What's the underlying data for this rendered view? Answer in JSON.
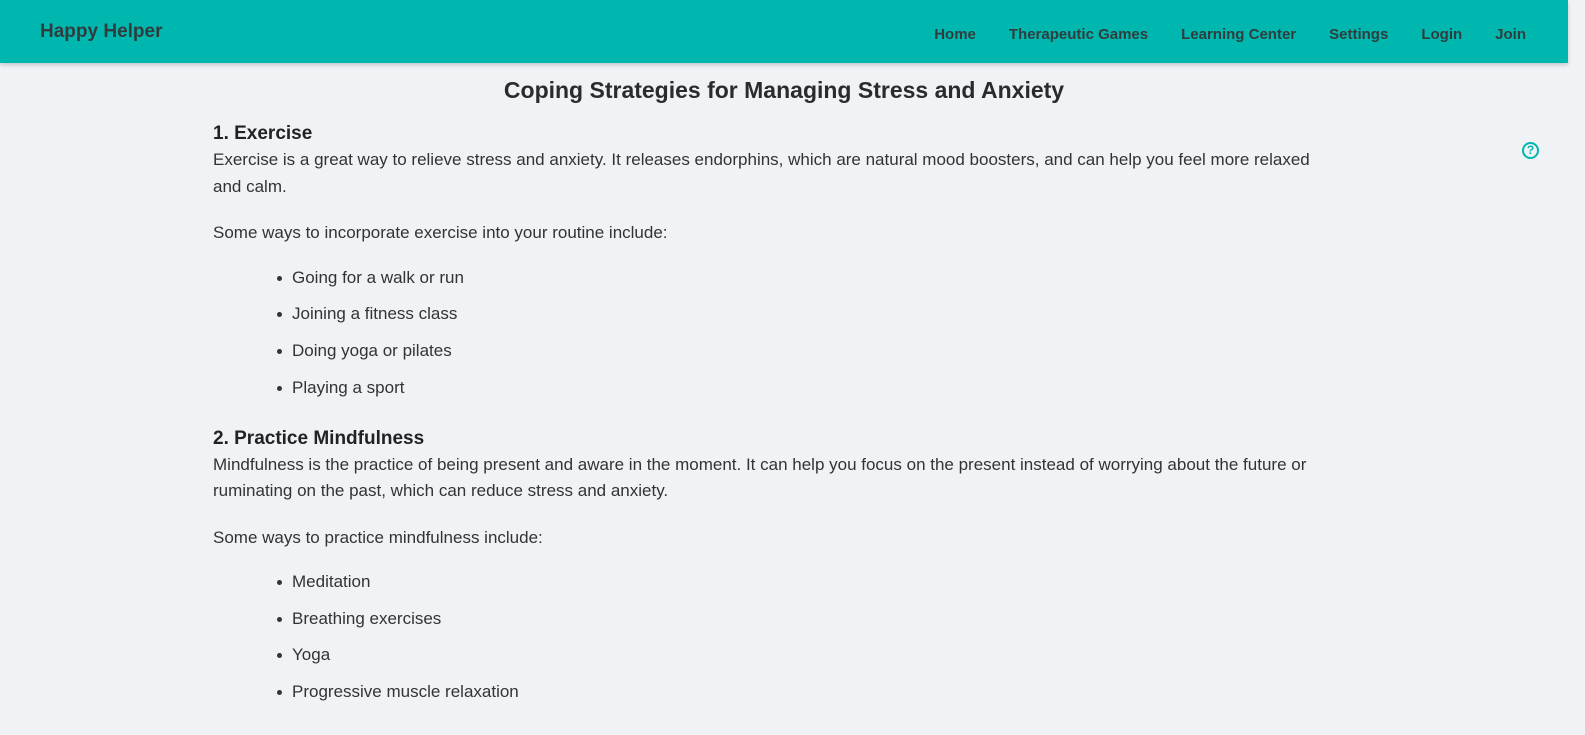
{
  "brand": "Happy Helper",
  "nav": {
    "items": [
      "Home",
      "Therapeutic Games",
      "Learning Center",
      "Settings",
      "Login",
      "Join"
    ]
  },
  "help_icon": "help-circle-icon",
  "page_title": "Coping Strategies for Managing Stress and Anxiety",
  "sections": [
    {
      "heading": "1. Exercise",
      "intro": "Exercise is a great way to relieve stress and anxiety. It releases endorphins, which are natural mood boosters, and can help you feel more relaxed and calm.",
      "lead": "Some ways to incorporate exercise into your routine include:",
      "items": [
        "Going for a walk or run",
        "Joining a fitness class",
        "Doing yoga or pilates",
        "Playing a sport"
      ]
    },
    {
      "heading": "2. Practice Mindfulness",
      "intro": "Mindfulness is the practice of being present and aware in the moment. It can help you focus on the present instead of worrying about the future or ruminating on the past, which can reduce stress and anxiety.",
      "lead": "Some ways to practice mindfulness include:",
      "items": [
        "Meditation",
        "Breathing exercises",
        "Yoga",
        "Progressive muscle relaxation"
      ]
    }
  ],
  "colors": {
    "accent": "#00b7b0",
    "background": "#eff3f6",
    "text": "#333333"
  }
}
